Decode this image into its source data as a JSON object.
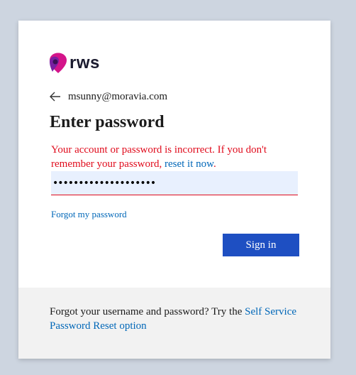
{
  "brand": {
    "logo_text": "rws",
    "colors": {
      "logo_magenta": "#d4148a",
      "logo_purple": "#7a1fa2",
      "logo_dark": "#3a0f55"
    }
  },
  "identity": {
    "email": "msunny@moravia.com",
    "back_icon": "arrow-left-icon"
  },
  "title": "Enter password",
  "error": {
    "message": "Your account or password is incorrect. If you don't remember your password,",
    "link_text": "reset it now",
    "suffix": "."
  },
  "password_field": {
    "value": "••••••••••••••••••••",
    "type": "password"
  },
  "forgot_link": "Forgot my password",
  "signin_button": "Sign in",
  "footer": {
    "text": "Forgot your username and password? Try the",
    "link_text": "Self Service Password Reset option"
  },
  "colors": {
    "page_background": "#cdd5e0",
    "error": "#e00b1c",
    "link": "#0067b8",
    "primary_button": "#1e4fc2",
    "footer_background": "#f2f2f2"
  }
}
